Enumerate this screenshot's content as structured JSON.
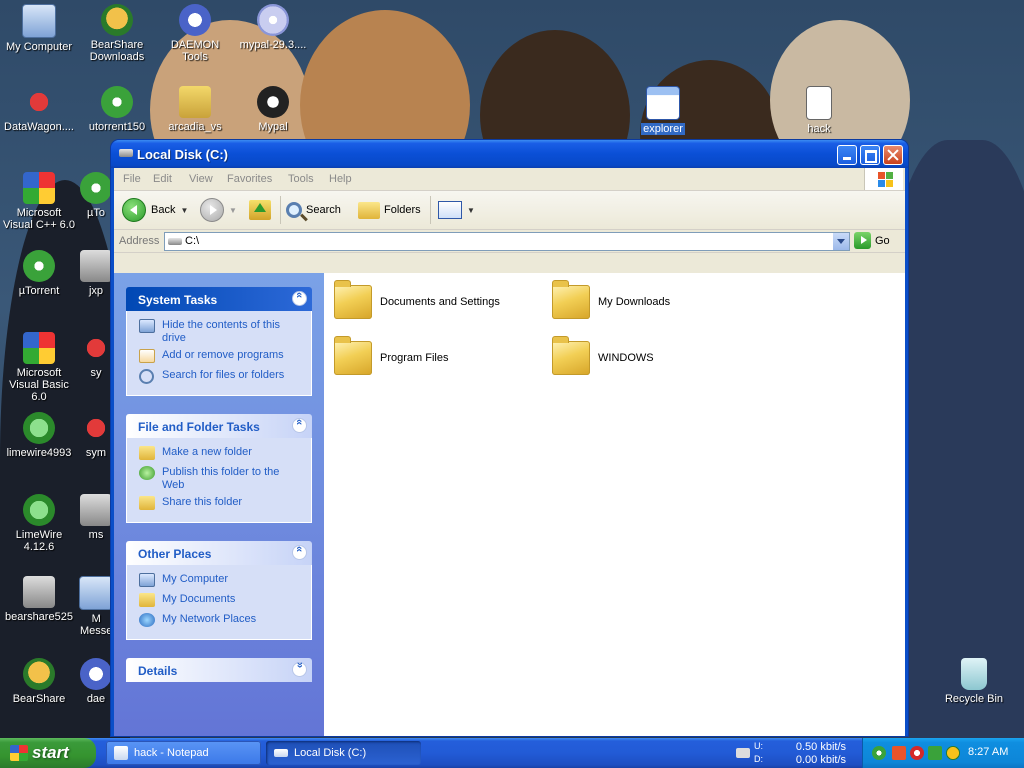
{
  "desktop": {
    "icons": [
      {
        "label": "My Computer"
      },
      {
        "label": "BearShare\nDownloads"
      },
      {
        "label": "DAEMON Tools"
      },
      {
        "label": "mypal-29.3...."
      },
      {
        "label": "DataWagon...."
      },
      {
        "label": "utorrent150"
      },
      {
        "label": "arcadia_vs"
      },
      {
        "label": "Mypal"
      },
      {
        "label": "explorer"
      },
      {
        "label": "hack"
      },
      {
        "label": "Microsoft Visual C++ 6.0"
      },
      {
        "label": "µTo"
      },
      {
        "label": "µTorrent"
      },
      {
        "label": "jxp"
      },
      {
        "label": "Microsoft Visual Basic 6.0"
      },
      {
        "label": "sy"
      },
      {
        "label": "limewire4993"
      },
      {
        "label": "sym"
      },
      {
        "label": "LimeWire 4.12.6"
      },
      {
        "label": "ms"
      },
      {
        "label": "bearshare525"
      },
      {
        "label": "M\nMesse"
      },
      {
        "label": "BearShare"
      },
      {
        "label": "dae"
      },
      {
        "label": "Recycle Bin"
      }
    ]
  },
  "window": {
    "title": "Local Disk (C:)",
    "menu": [
      "File",
      "Edit",
      "View",
      "Favorites",
      "Tools",
      "Help"
    ],
    "toolbar": {
      "back": "Back",
      "search": "Search",
      "folders": "Folders"
    },
    "address": {
      "label": "Address",
      "value": "C:\\",
      "go": "Go"
    },
    "tasks": {
      "system": {
        "title": "System Tasks",
        "items": [
          "Hide the contents of this drive",
          "Add or remove programs",
          "Search for files or folders"
        ]
      },
      "file_folder": {
        "title": "File and Folder Tasks",
        "items": [
          "Make a new folder",
          "Publish this folder to the Web",
          "Share this folder"
        ]
      },
      "other": {
        "title": "Other Places",
        "items": [
          "My Computer",
          "My Documents",
          "My Network Places"
        ]
      },
      "details": {
        "title": "Details"
      }
    },
    "files": [
      "Documents and Settings",
      "My Downloads",
      "Program Files",
      "WINDOWS"
    ]
  },
  "taskbar": {
    "start": "start",
    "tasks": [
      {
        "title": "hack - Notepad",
        "active": false
      },
      {
        "title": "Local Disk (C:)",
        "active": true
      }
    ],
    "netmon": {
      "u_label": "U:",
      "d_label": "D:",
      "up": "0.50 kbit/s",
      "down": "0.00 kbit/s"
    },
    "clock": "8:27 AM"
  }
}
